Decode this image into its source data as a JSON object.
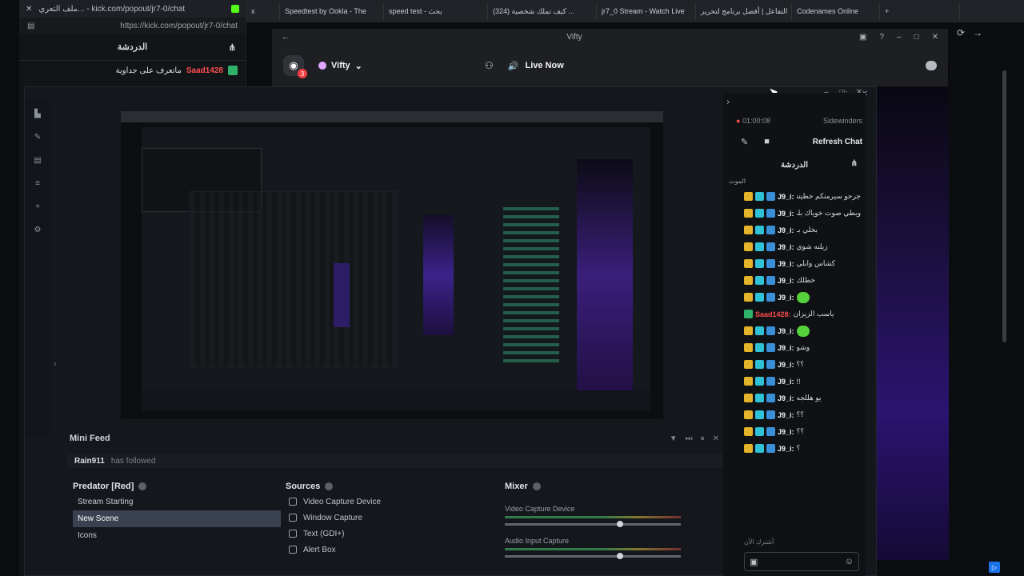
{
  "popout": {
    "tab_title": "ملف التعري... - kick.com/popout/jr7-0/chat",
    "url": "https://kick.com/popout/jr7-0/chat",
    "header": "الدردشة",
    "message_user": "Saad1428",
    "message_text": "ماتعرف على جداوية"
  },
  "tabs": [
    {
      "label": "x"
    },
    {
      "label": "Speedtest by Ookla - The"
    },
    {
      "label": "speed test - بحث"
    },
    {
      "label": "(324) كيف تملك شخصية ..."
    },
    {
      "label": "jr7_0 Stream - Watch Live"
    },
    {
      "label": "التفاعل | أفضل برنامج لتحرير"
    },
    {
      "label": "Codenames Online"
    },
    {
      "label": "+"
    }
  ],
  "discord": {
    "title": "Vifty",
    "server": "Vifty",
    "notif_count": "3",
    "live_label": "Live Now"
  },
  "obs": {
    "minifeed_title": "Mini Feed",
    "minifeed_user": "Rain911",
    "minifeed_event": "has followed",
    "scenes_title": "Predator [Red]",
    "scenes": [
      "Stream Starting",
      "New Scene",
      "Icons"
    ],
    "selected_scene": "New Scene",
    "sources_title": "Sources",
    "sources": [
      "Video Capture Device",
      "Window Capture",
      "Text (GDI+)",
      "Alert Box"
    ],
    "mixer_title": "Mixer",
    "mixer_channels": [
      "Video Capture Device",
      "Audio Input Capture"
    ]
  },
  "chat": {
    "timer": "01:00:08",
    "viewers": "Sidewinders",
    "refresh_label": "Refresh Chat",
    "header": "الدردشة",
    "sub": "الموت",
    "messages": [
      {
        "user": "J9_i:",
        "text": "جرحو سيرمنكم خطيتنت"
      },
      {
        "user": "J9_i:",
        "text": "وبطي صوت خوياك بلي بزيك"
      },
      {
        "user": "J9_i:",
        "text": "بخلي بـ"
      },
      {
        "user": "J9_i:",
        "text": "زيلنه شوي"
      },
      {
        "user": "J9_i:",
        "text": "كشاس وابلي"
      },
      {
        "user": "J9_i:",
        "text": "خطلك"
      },
      {
        "user": "J9_i:",
        "text": ""
      },
      {
        "user": "Saad1428:",
        "text": "ياسب الزيزان"
      },
      {
        "user": "J9_i:",
        "text": ""
      },
      {
        "user": "J9_i:",
        "text": "وشو"
      },
      {
        "user": "J9_i:",
        "text": "؟؟"
      },
      {
        "user": "J9_i:",
        "text": "!!"
      },
      {
        "user": "J9_i:",
        "text": "يو هللجه"
      },
      {
        "user": "J9_i:",
        "text": "؟؟"
      },
      {
        "user": "J9_i:",
        "text": "؟؟"
      },
      {
        "user": "J9_i:",
        "text": "؟"
      }
    ],
    "footer": "أشترك الآن"
  }
}
